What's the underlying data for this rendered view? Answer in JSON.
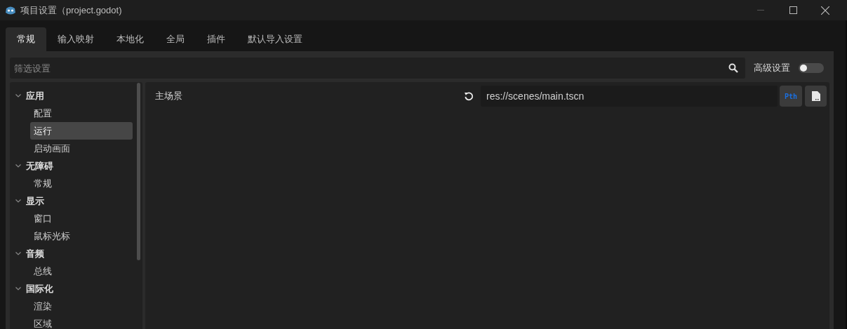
{
  "window": {
    "title": "项目设置（project.godot)"
  },
  "tabs": [
    {
      "label": "常规",
      "selected": true
    },
    {
      "label": "输入映射",
      "selected": false
    },
    {
      "label": "本地化",
      "selected": false
    },
    {
      "label": "全局",
      "selected": false
    },
    {
      "label": "插件",
      "selected": false
    },
    {
      "label": "默认导入设置",
      "selected": false
    }
  ],
  "filter": {
    "placeholder": "筛选设置"
  },
  "advanced": {
    "label": "高级设置",
    "on": false
  },
  "tree": [
    {
      "label": "应用",
      "expanded": true,
      "children": [
        {
          "label": "配置",
          "selected": false
        },
        {
          "label": "运行",
          "selected": true
        },
        {
          "label": "启动画面",
          "selected": false
        }
      ]
    },
    {
      "label": "无障碍",
      "expanded": true,
      "children": [
        {
          "label": "常规",
          "selected": false
        }
      ]
    },
    {
      "label": "显示",
      "expanded": true,
      "children": [
        {
          "label": "窗口",
          "selected": false
        },
        {
          "label": "鼠标光标",
          "selected": false
        }
      ]
    },
    {
      "label": "音频",
      "expanded": true,
      "children": [
        {
          "label": "总线",
          "selected": false
        }
      ]
    },
    {
      "label": "国际化",
      "expanded": true,
      "children": [
        {
          "label": "渲染",
          "selected": false
        },
        {
          "label": "区域",
          "selected": false
        }
      ]
    }
  ],
  "settings": [
    {
      "label": "主场景",
      "value": "res://scenes/main.tscn",
      "path_button": "Pth"
    }
  ]
}
